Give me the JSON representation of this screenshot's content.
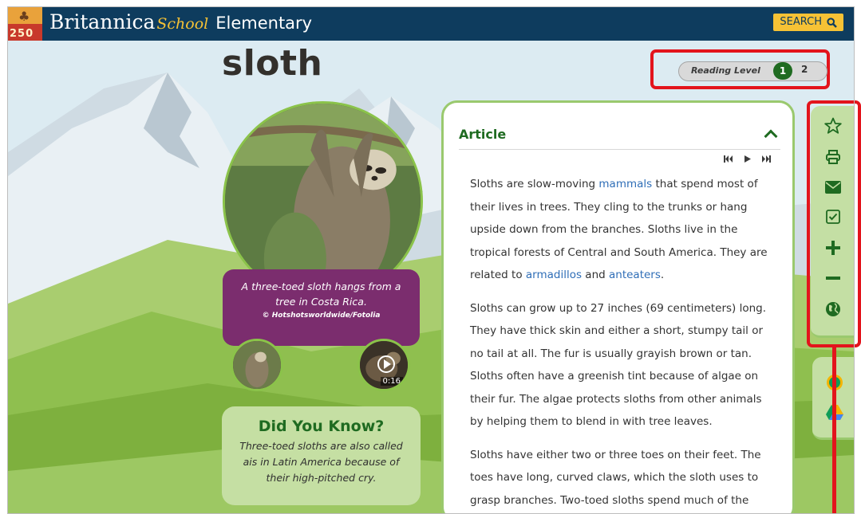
{
  "header": {
    "logo_number": "250",
    "brand_name": "Britannica",
    "brand_school": "School",
    "brand_level": "Elementary",
    "search_label": "SEARCH"
  },
  "page": {
    "title": "sloth"
  },
  "reading_level": {
    "label": "Reading Level",
    "level_1": "1",
    "level_2": "2",
    "selected": "1"
  },
  "media": {
    "caption": "A three-toed sloth hangs from a tree in Costa Rica.",
    "credit": "© Hotshotsworldwide/Fotolia",
    "video_duration": "0:16"
  },
  "did_you_know": {
    "title": "Did You Know?",
    "text": "Three-toed sloths are also called ais in Latin America because of their high-pitched cry."
  },
  "article": {
    "heading": "Article",
    "p1_a": "Sloths are slow-moving ",
    "p1_link1": "mammals",
    "p1_b": " that spend most of their lives in trees. They cling to the trunks or hang upside down from the branches. Sloths live in the tropical forests of Central and South America. They are related to ",
    "p1_link2": "armadillos",
    "p1_c": " and ",
    "p1_link3": "anteaters",
    "p1_d": ".",
    "p2": "Sloths can grow up to 27 inches (69 centimeters) long. They have thick skin and either a short, stumpy tail or no tail at all. The fur is usually grayish brown or tan. Sloths often have a greenish tint because of algae on their fur. The algae protects sloths from other animals by helping them to blend in with tree leaves.",
    "p3": "Sloths have either two or three toes on their feet. The toes have long, curved claws, which the sloth uses to grasp branches. Two-toed sloths spend much of the"
  },
  "toolbar": {
    "tools": [
      "star-icon",
      "print-icon",
      "email-icon",
      "checkbox-icon",
      "plus-icon",
      "minus-icon",
      "globe-icon"
    ],
    "share": [
      "google-classroom-icon",
      "google-drive-icon"
    ]
  },
  "colors": {
    "header_bg": "#0e3c5e",
    "accent_yellow": "#f6c235",
    "green": "#1f6b21",
    "caption_purple": "#7b2d6e",
    "highlight_red": "#e3141c",
    "link_blue": "#2f6eb7"
  }
}
